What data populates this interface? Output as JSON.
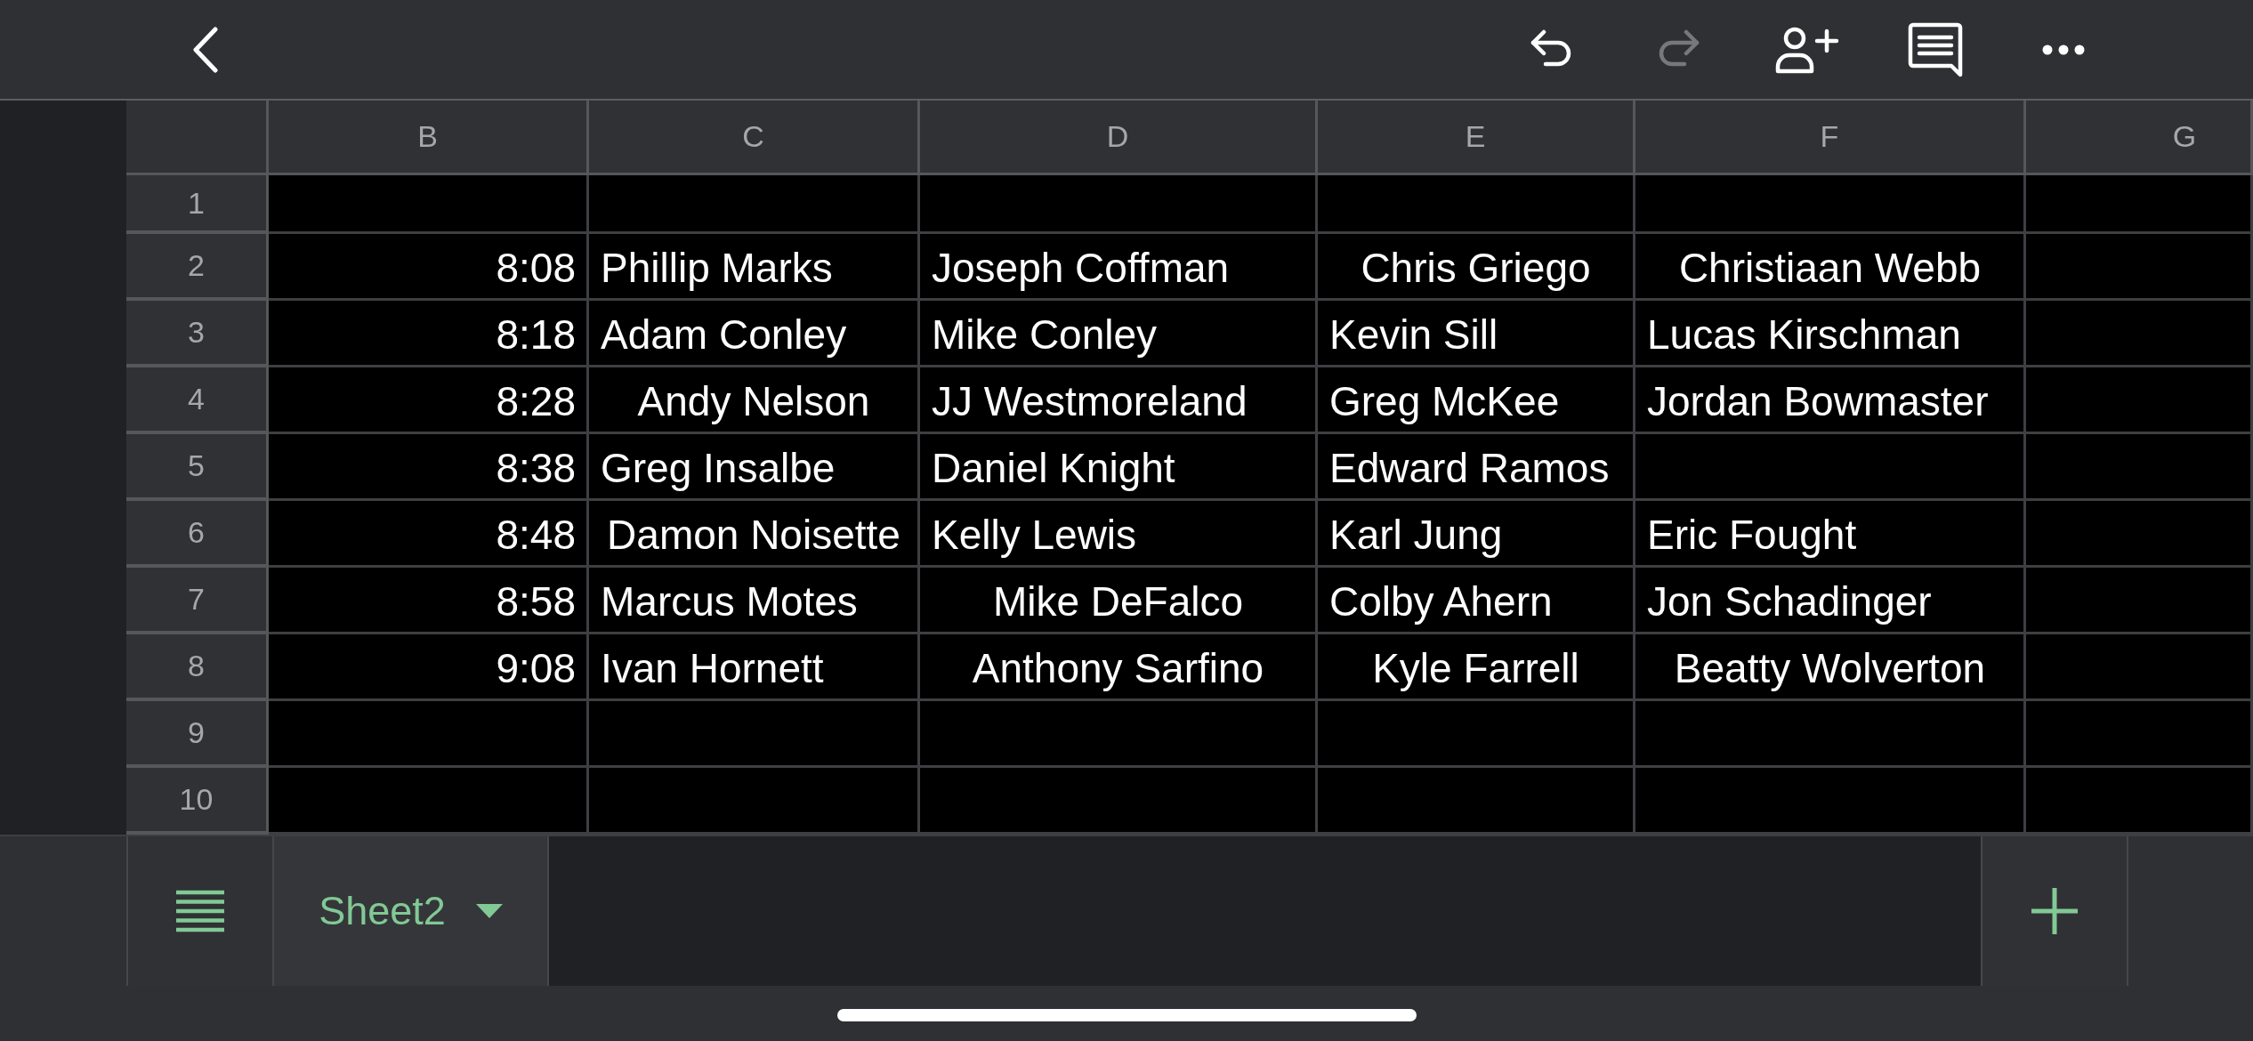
{
  "toolbar": {
    "undo": {
      "disabled": false
    },
    "redo": {
      "disabled": true
    }
  },
  "sheet": {
    "columns": [
      "B",
      "C",
      "D",
      "E",
      "F",
      "G"
    ],
    "rows": [
      {
        "number": "1",
        "cells": [
          {},
          {},
          {},
          {},
          {},
          {}
        ]
      },
      {
        "number": "2",
        "cells": [
          {
            "kind": "time",
            "text": "8:08"
          },
          {
            "kind": "text",
            "text": "Phillip Marks",
            "centered": false
          },
          {
            "kind": "text",
            "text": "Joseph Coffman",
            "centered": false
          },
          {
            "kind": "text",
            "text": "Chris Griego",
            "centered": true
          },
          {
            "kind": "text",
            "text": "Christiaan Webb",
            "centered": true
          },
          {}
        ]
      },
      {
        "number": "3",
        "cells": [
          {
            "kind": "time",
            "text": "8:18"
          },
          {
            "kind": "text",
            "text": "Adam Conley",
            "centered": false
          },
          {
            "kind": "text",
            "text": "Mike Conley",
            "centered": false
          },
          {
            "kind": "text",
            "text": "Kevin Sill",
            "centered": false
          },
          {
            "kind": "text",
            "text": "Lucas Kirschman",
            "centered": false
          },
          {}
        ]
      },
      {
        "number": "4",
        "cells": [
          {
            "kind": "time",
            "text": "8:28"
          },
          {
            "kind": "text",
            "text": "Andy Nelson",
            "centered": true
          },
          {
            "kind": "text",
            "text": "JJ Westmoreland",
            "centered": false
          },
          {
            "kind": "text",
            "text": "Greg McKee",
            "centered": false
          },
          {
            "kind": "text",
            "text": "Jordan Bowmaster",
            "centered": false
          },
          {}
        ]
      },
      {
        "number": "5",
        "cells": [
          {
            "kind": "time",
            "text": "8:38"
          },
          {
            "kind": "text",
            "text": "Greg Insalbe",
            "centered": false
          },
          {
            "kind": "text",
            "text": "Daniel Knight",
            "centered": false
          },
          {
            "kind": "text",
            "text": "Edward Ramos",
            "centered": false
          },
          {},
          {}
        ]
      },
      {
        "number": "6",
        "cells": [
          {
            "kind": "time",
            "text": "8:48"
          },
          {
            "kind": "text",
            "text": "Damon Noisette",
            "centered": true
          },
          {
            "kind": "text",
            "text": "Kelly Lewis",
            "centered": false
          },
          {
            "kind": "text",
            "text": "Karl Jung",
            "centered": false
          },
          {
            "kind": "text",
            "text": "Eric Fought",
            "centered": false
          },
          {}
        ]
      },
      {
        "number": "7",
        "cells": [
          {
            "kind": "time",
            "text": "8:58"
          },
          {
            "kind": "text",
            "text": "Marcus Motes",
            "centered": false
          },
          {
            "kind": "text",
            "text": "Mike DeFalco",
            "centered": true
          },
          {
            "kind": "text",
            "text": "Colby Ahern",
            "centered": false
          },
          {
            "kind": "text",
            "text": "Jon Schadinger",
            "centered": false
          },
          {}
        ]
      },
      {
        "number": "8",
        "cells": [
          {
            "kind": "time",
            "text": "9:08"
          },
          {
            "kind": "text",
            "text": "Ivan Hornett",
            "centered": false
          },
          {
            "kind": "text",
            "text": "Anthony Sarfino",
            "centered": true
          },
          {
            "kind": "text",
            "text": "Kyle Farrell",
            "centered": true
          },
          {
            "kind": "text",
            "text": "Beatty Wolverton",
            "centered": true
          },
          {}
        ]
      },
      {
        "number": "9",
        "cells": [
          {},
          {},
          {},
          {},
          {},
          {}
        ]
      },
      {
        "number": "10",
        "cells": [
          {},
          {},
          {},
          {},
          {},
          {}
        ]
      }
    ]
  },
  "sheet_tabs": [
    {
      "label": "Sheet2",
      "selected": true
    }
  ]
}
